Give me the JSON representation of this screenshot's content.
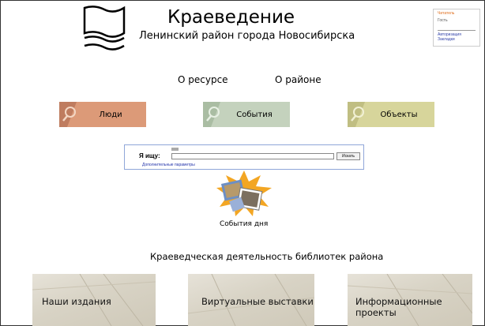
{
  "header": {
    "title": "Краеведение",
    "subtitle": "Ленинский район города Новосибирска"
  },
  "reader": {
    "title": "Читатель",
    "text": "Гость",
    "auth_link": "Авторизация",
    "bookmarks_link": "Закладки"
  },
  "nav": {
    "about_resource": "О ресурсе",
    "about_district": "О районе"
  },
  "categories": [
    {
      "label": "Люди",
      "color": "#dc9a78"
    },
    {
      "label": "События",
      "color": "#c4d2bd"
    },
    {
      "label": "Объекты",
      "color": "#d7d59b"
    }
  ],
  "search": {
    "label": "Я ищу:",
    "value": "",
    "button": "Искать",
    "advanced_link": "Дополнительные параметры"
  },
  "events_day": {
    "label": "События дня"
  },
  "section": {
    "title": "Краеведческая деятельность библиотек района"
  },
  "tiles": [
    {
      "label": "Наши издания"
    },
    {
      "label": "Виртуальные выставки"
    },
    {
      "label": "Информационные проекты"
    }
  ]
}
